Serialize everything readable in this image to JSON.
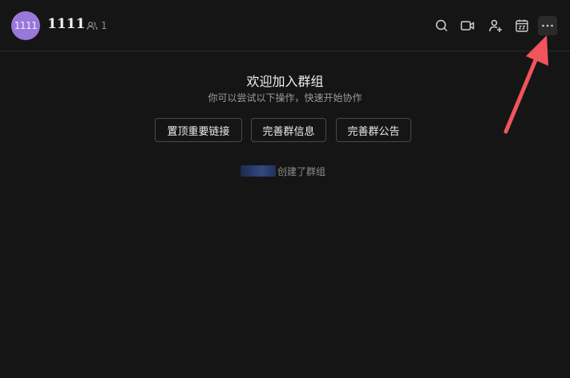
{
  "header": {
    "avatar_text": "1111",
    "group_name": "1111",
    "member_count": "1",
    "toolbar": [
      {
        "name": "search-icon"
      },
      {
        "name": "video-call-icon"
      },
      {
        "name": "add-member-icon"
      },
      {
        "name": "calendar-icon"
      },
      {
        "name": "more-icon"
      }
    ]
  },
  "welcome": {
    "title": "欢迎加入群组",
    "subtitle": "你可以尝试以下操作，快速开始协作",
    "actions": [
      {
        "label": "置顶重要链接"
      },
      {
        "label": "完善群信息"
      },
      {
        "label": "完善群公告"
      }
    ],
    "creator_text": "创建了群组"
  },
  "colors": {
    "background": "#151515",
    "avatar": "#9a78d9",
    "annotation_arrow": "#f0545c"
  }
}
